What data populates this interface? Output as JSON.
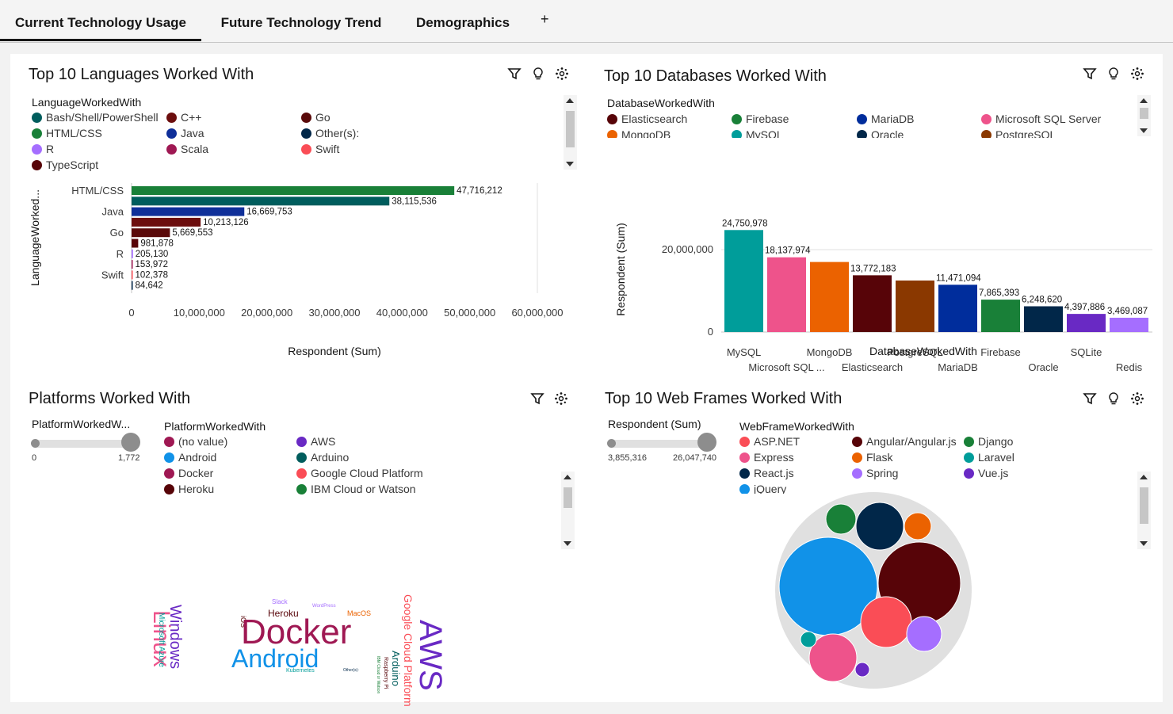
{
  "tabs": [
    {
      "label": "Current Technology Usage",
      "active": true
    },
    {
      "label": "Future Technology Trend",
      "active": false
    },
    {
      "label": "Demographics",
      "active": false
    }
  ],
  "tab_add_label": "+",
  "panels": {
    "languages": {
      "title": "Top 10 Languages Worked With",
      "legend_title": "LanguageWorkedWith",
      "legend": [
        {
          "label": "Bash/Shell/PowerShell",
          "color": "#005d5d"
        },
        {
          "label": "C++",
          "color": "#6c0e0e"
        },
        {
          "label": "Go",
          "color": "#5a0a0a"
        },
        {
          "label": "HTML/CSS",
          "color": "#198038"
        },
        {
          "label": "Java",
          "color": "#0f2f99"
        },
        {
          "label": "Other(s):",
          "color": "#012749"
        },
        {
          "label": "R",
          "color": "#a56eff"
        },
        {
          "label": "Scala",
          "color": "#9f1853"
        },
        {
          "label": "Swift",
          "color": "#fa4d56"
        },
        {
          "label": "TypeScript",
          "color": "#570408"
        }
      ]
    },
    "databases": {
      "title": "Top 10 Databases Worked With",
      "legend_title": "DatabaseWorkedWith",
      "legend": [
        {
          "label": "Elasticsearch",
          "color": "#570408"
        },
        {
          "label": "Firebase",
          "color": "#198038"
        },
        {
          "label": "MariaDB",
          "color": "#002d9c"
        },
        {
          "label": "Microsoft SQL Server",
          "color": "#ee538b"
        },
        {
          "label": "MongoDB",
          "color": "#eb6200"
        },
        {
          "label": "MySQL",
          "color": "#009d9a"
        },
        {
          "label": "Oracle",
          "color": "#012749"
        },
        {
          "label": "PostgreSQL",
          "color": "#8a3800"
        }
      ]
    },
    "platforms": {
      "title": "Platforms Worked With",
      "slider_label": "PlatformWorkedW...",
      "slider_min": "0",
      "slider_max": "1,772",
      "legend_title": "PlatformWorkedWith",
      "legend": [
        {
          "label": "(no value)",
          "color": "#9f1853"
        },
        {
          "label": "AWS",
          "color": "#6929c4"
        },
        {
          "label": "Android",
          "color": "#1192e8"
        },
        {
          "label": "Arduino",
          "color": "#005d5d"
        },
        {
          "label": "Docker",
          "color": "#9f1853"
        },
        {
          "label": "Google Cloud Platform",
          "color": "#fa4d56"
        },
        {
          "label": "Heroku",
          "color": "#570408"
        },
        {
          "label": "IBM Cloud or Watson",
          "color": "#198038"
        }
      ],
      "words": [
        {
          "text": "Linux",
          "color": "#ee538b",
          "size": 30,
          "rot": 90
        },
        {
          "text": "Windows",
          "color": "#6929c4",
          "size": 20,
          "rot": 90
        },
        {
          "text": "Microsoft Azure",
          "color": "#009d9a",
          "size": 10,
          "rot": 90
        },
        {
          "text": "iOS",
          "color": "#570408",
          "size": 9,
          "rot": -90
        },
        {
          "text": "Slack",
          "color": "#a56eff",
          "size": 8,
          "rot": 0
        },
        {
          "text": "WordPress",
          "color": "#a56eff",
          "size": 6,
          "rot": 0
        },
        {
          "text": "Heroku",
          "color": "#570408",
          "size": 12,
          "rot": 0
        },
        {
          "text": "MacOS",
          "color": "#eb6200",
          "size": 9,
          "rot": 0
        },
        {
          "text": "Docker",
          "color": "#9f1853",
          "size": 44,
          "rot": 0
        },
        {
          "text": "Android",
          "color": "#1192e8",
          "size": 32,
          "rot": 0
        },
        {
          "text": "Kubernetes",
          "color": "#009d9a",
          "size": 7,
          "rot": 0
        },
        {
          "text": "Other(s):",
          "color": "#012749",
          "size": 5,
          "rot": 0
        },
        {
          "text": "Google Cloud Platform",
          "color": "#fa4d56",
          "size": 14,
          "rot": 90
        },
        {
          "text": "Arduino",
          "color": "#005d5d",
          "size": 13,
          "rot": 90
        },
        {
          "text": "Raspberry Pi",
          "color": "#570408",
          "size": 7,
          "rot": 90
        },
        {
          "text": "IBM Cloud or Watson",
          "color": "#198038",
          "size": 5,
          "rot": 90
        },
        {
          "text": "AWS",
          "color": "#6929c4",
          "size": 40,
          "rot": 90
        }
      ]
    },
    "webframes": {
      "title": "Top 10 Web Frames Worked With",
      "slider_label": "Respondent (Sum)",
      "slider_min": "3,855,316",
      "slider_max": "26,047,740",
      "legend_title": "WebFrameWorkedWith",
      "legend": [
        {
          "label": "ASP.NET",
          "color": "#fa4d56"
        },
        {
          "label": "Angular/Angular.js",
          "color": "#570408"
        },
        {
          "label": "Django",
          "color": "#198038"
        },
        {
          "label": "Express",
          "color": "#ee538b"
        },
        {
          "label": "Flask",
          "color": "#eb6200"
        },
        {
          "label": "Laravel",
          "color": "#009d9a"
        },
        {
          "label": "React.js",
          "color": "#012749"
        },
        {
          "label": "Spring",
          "color": "#a56eff"
        },
        {
          "label": "Vue.js",
          "color": "#6929c4"
        },
        {
          "label": "jQuery",
          "color": "#1192e8"
        }
      ]
    }
  },
  "chart_data": [
    {
      "type": "bar",
      "orientation": "horizontal",
      "title": "Top 10 Languages Worked With",
      "xlabel": "Respondent (Sum)",
      "ylabel": "LanguageWorked...",
      "xlim": [
        0,
        60000000
      ],
      "xticks": [
        "0",
        "10,000,000",
        "20,000,000",
        "30,000,000",
        "40,000,000",
        "50,000,000",
        "60,000,000"
      ],
      "yticks": [
        "HTML/CSS",
        "Java",
        "Go",
        "R",
        "Swift"
      ],
      "bars": [
        {
          "value": 47716212,
          "label": "47,716,212",
          "color": "#198038"
        },
        {
          "value": 38115536,
          "label": "38,115,536",
          "color": "#005d5d"
        },
        {
          "value": 16669753,
          "label": "16,669,753",
          "color": "#0f2f99"
        },
        {
          "value": 10213126,
          "label": "10,213,126",
          "color": "#6c0e0e"
        },
        {
          "value": 5669553,
          "label": "5,669,553",
          "color": "#5a0a0a"
        },
        {
          "value": 981878,
          "label": "981,878",
          "color": "#570408"
        },
        {
          "value": 205130,
          "label": "205,130",
          "color": "#a56eff"
        },
        {
          "value": 153972,
          "label": "153,972",
          "color": "#9f1853"
        },
        {
          "value": 102378,
          "label": "102,378",
          "color": "#fa4d56"
        },
        {
          "value": 84642,
          "label": "84,642",
          "color": "#012749"
        }
      ]
    },
    {
      "type": "bar",
      "title": "Top 10 Databases Worked With",
      "xlabel": "DatabaseWorkedWith",
      "ylabel": "Respondent (Sum)",
      "ylim": [
        0,
        25000000
      ],
      "yticks": [
        "0",
        "20,000,000"
      ],
      "categories_top": [
        "MySQL",
        "MongoDB",
        "PostgreSQL",
        "Firebase",
        "SQLite"
      ],
      "categories_bottom": [
        "Microsoft SQL ...",
        "Elasticsearch",
        "MariaDB",
        "Oracle",
        "Redis"
      ],
      "bars": [
        {
          "value": 24750978,
          "label": "24,750,978",
          "color": "#009d9a"
        },
        {
          "value": 18137974,
          "label": "18,137,974",
          "color": "#ee538b"
        },
        {
          "value": 17000000,
          "label": "",
          "color": "#eb6200"
        },
        {
          "value": 13772183,
          "label": "13,772,183",
          "color": "#570408"
        },
        {
          "value": 12500000,
          "label": "",
          "color": "#8a3800"
        },
        {
          "value": 11471094,
          "label": "11,471,094",
          "color": "#002d9c"
        },
        {
          "value": 7865393,
          "label": "7,865,393",
          "color": "#198038"
        },
        {
          "value": 6248620,
          "label": "6,248,620",
          "color": "#012749"
        },
        {
          "value": 4397886,
          "label": "4,397,886",
          "color": "#6929c4"
        },
        {
          "value": 3469087,
          "label": "3,469,087",
          "color": "#a56eff"
        }
      ]
    }
  ],
  "bubbles": [
    {
      "name": "jQuery",
      "color": "#1192e8",
      "r": 62
    },
    {
      "name": "Angular/Angular.js",
      "color": "#570408",
      "r": 52
    },
    {
      "name": "React.js",
      "color": "#012749",
      "r": 30
    },
    {
      "name": "Django",
      "color": "#198038",
      "r": 19
    },
    {
      "name": "Flask",
      "color": "#eb6200",
      "r": 17
    },
    {
      "name": "ASP.NET",
      "color": "#fa4d56",
      "r": 32
    },
    {
      "name": "Express",
      "color": "#ee538b",
      "r": 30
    },
    {
      "name": "Spring",
      "color": "#a56eff",
      "r": 22
    },
    {
      "name": "Laravel",
      "color": "#009d9a",
      "r": 10
    },
    {
      "name": "Vue.js",
      "color": "#6929c4",
      "r": 9
    }
  ]
}
